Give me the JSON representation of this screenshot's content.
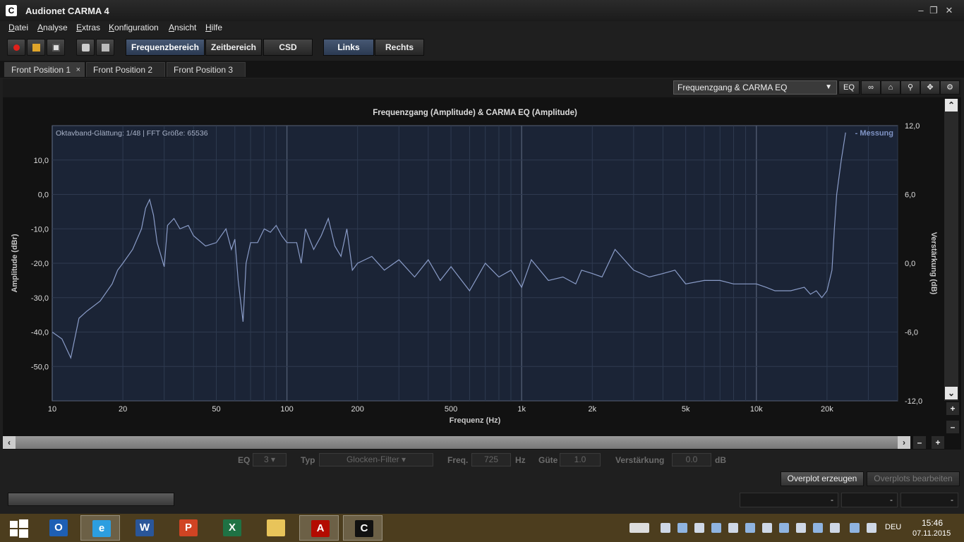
{
  "window": {
    "title": "Audionet CARMA 4",
    "icon_letter": "C"
  },
  "menu": [
    {
      "pre": "",
      "u": "D",
      "post": "atei"
    },
    {
      "pre": "",
      "u": "A",
      "post": "nalyse"
    },
    {
      "pre": "",
      "u": "E",
      "post": "xtras"
    },
    {
      "pre": "",
      "u": "K",
      "post": "onfiguration"
    },
    {
      "pre": "",
      "u": "A",
      "post": "nsicht"
    },
    {
      "pre": "",
      "u": "H",
      "post": "ilfe"
    }
  ],
  "toolbar": {
    "domain_buttons": [
      "Frequenzbereich",
      "Zeitbereich",
      "CSD"
    ],
    "active_domain": "Frequenzbereich",
    "channel_buttons": [
      "Links",
      "Rechts"
    ],
    "active_channel": "Links"
  },
  "tabs": [
    {
      "label": "Front Position 1",
      "active": true,
      "closable": true
    },
    {
      "label": "Front Position 2",
      "active": false
    },
    {
      "label": "Front Position 3",
      "active": false
    }
  ],
  "plot_toolbar": {
    "view_select": "Frequenzgang & CARMA EQ",
    "eq_button": "EQ",
    "icons": [
      "link-icon",
      "home-icon",
      "zoom-icon",
      "pan-icon",
      "settings-icon"
    ]
  },
  "chart_data": {
    "type": "line",
    "title": "Frequenzgang (Amplitude) & CARMA EQ (Amplitude)",
    "annotation": "Oktavband-Glättung: 1/48 | FFT Größe: 65536",
    "legend": [
      "- Messung"
    ],
    "legend_position": "top-right",
    "xlabel": "Frequenz (Hz)",
    "ylabel_left": "Amplitude (dBr)",
    "ylabel_right": "Verstärkung (dB)",
    "x_scale": "log",
    "xlim": [
      10,
      40000
    ],
    "ylim_left": [
      -60,
      20
    ],
    "ylim_right": [
      -12,
      12
    ],
    "x_ticks": [
      "10",
      "20",
      "50",
      "100",
      "200",
      "500",
      "1k",
      "2k",
      "5k",
      "10k",
      "20k"
    ],
    "y_ticks_left": [
      "10,0",
      "0,0",
      "-10,0",
      "-20,0",
      "-30,0",
      "-40,0",
      "-50,0"
    ],
    "y_ticks_right": [
      "12,0",
      "6,0",
      "0,0",
      "-6,0",
      "-12,0"
    ],
    "grid": true,
    "colors": {
      "plot_bg": "#1b2436",
      "line": "#8a9cc8",
      "legend": "#7f93c4"
    },
    "series": [
      {
        "name": "Messung",
        "x": [
          10,
          11,
          12,
          13,
          14,
          16,
          18,
          19,
          20,
          22,
          24,
          25,
          26,
          27,
          28,
          30,
          31,
          33,
          35,
          38,
          40,
          45,
          50,
          55,
          58,
          60,
          62,
          65,
          67,
          70,
          75,
          80,
          85,
          90,
          95,
          100,
          110,
          115,
          120,
          130,
          140,
          150,
          160,
          170,
          180,
          190,
          200,
          230,
          260,
          300,
          350,
          400,
          450,
          500,
          600,
          700,
          800,
          900,
          1000,
          1100,
          1300,
          1500,
          1700,
          1800,
          2000,
          2200,
          2500,
          3000,
          3500,
          4000,
          4500,
          5000,
          6000,
          7000,
          8000,
          9000,
          10000,
          11000,
          12000,
          14000,
          16000,
          17000,
          18000,
          19000,
          20000,
          21000,
          21500,
          22000,
          23000,
          24000
        ],
        "y": [
          -40,
          -42,
          -47.5,
          -36,
          -34,
          -31,
          -26,
          -22,
          -20,
          -16,
          -10,
          -4,
          -1.5,
          -6,
          -14,
          -21,
          -9,
          -7,
          -10,
          -9,
          -12,
          -15,
          -14,
          -10,
          -16,
          -13,
          -25,
          -37,
          -20,
          -14,
          -14,
          -10,
          -11,
          -9,
          -12,
          -14,
          -14,
          -20,
          -10,
          -16,
          -12,
          -7,
          -15,
          -18,
          -10,
          -22,
          -20,
          -18,
          -22,
          -19,
          -24,
          -19,
          -25,
          -21,
          -28,
          -20,
          -24,
          -22,
          -27,
          -19,
          -25,
          -24,
          -26,
          -22,
          -23,
          -24,
          -16,
          -22,
          -24,
          -23,
          -22,
          -26,
          -25,
          -25,
          -26,
          -26,
          -26,
          -27,
          -28,
          -28,
          -27,
          -29,
          -28,
          -30,
          -28,
          -22,
          -10,
          0,
          10,
          18
        ]
      }
    ]
  },
  "eq_controls": {
    "eq_label": "EQ",
    "eq_value": "3",
    "typ_label": "Typ",
    "typ_value": "Glocken-Filter",
    "freq_label": "Freq.",
    "freq_value": "725",
    "freq_unit": "Hz",
    "gute_label": "Güte",
    "gute_value": "1.0",
    "gain_label": "Verstärkung",
    "gain_value": "0.0",
    "gain_unit": "dB"
  },
  "overplot": {
    "create": "Overplot erzeugen",
    "edit": "Overplots bearbeiten"
  },
  "status": {
    "box1": "-",
    "box2": "-",
    "box3": "-"
  },
  "taskbar": {
    "apps": [
      {
        "name": "outlook-icon",
        "color": "#1e5fb4",
        "letter": "O"
      },
      {
        "name": "internet-explorer-icon",
        "color": "#2c9ee0",
        "letter": "e"
      },
      {
        "name": "word-icon",
        "color": "#2a5699",
        "letter": "W"
      },
      {
        "name": "powerpoint-icon",
        "color": "#d04423",
        "letter": "P"
      },
      {
        "name": "excel-icon",
        "color": "#1f7244",
        "letter": "X"
      },
      {
        "name": "file-explorer-icon",
        "color": "#e8c45a",
        "letter": ""
      },
      {
        "name": "acrobat-icon",
        "color": "#b30b00",
        "letter": "A"
      },
      {
        "name": "carma-icon",
        "color": "#111111",
        "letter": "C"
      }
    ],
    "language": "DEU",
    "time": "15:46",
    "date": "07.11.2015"
  }
}
